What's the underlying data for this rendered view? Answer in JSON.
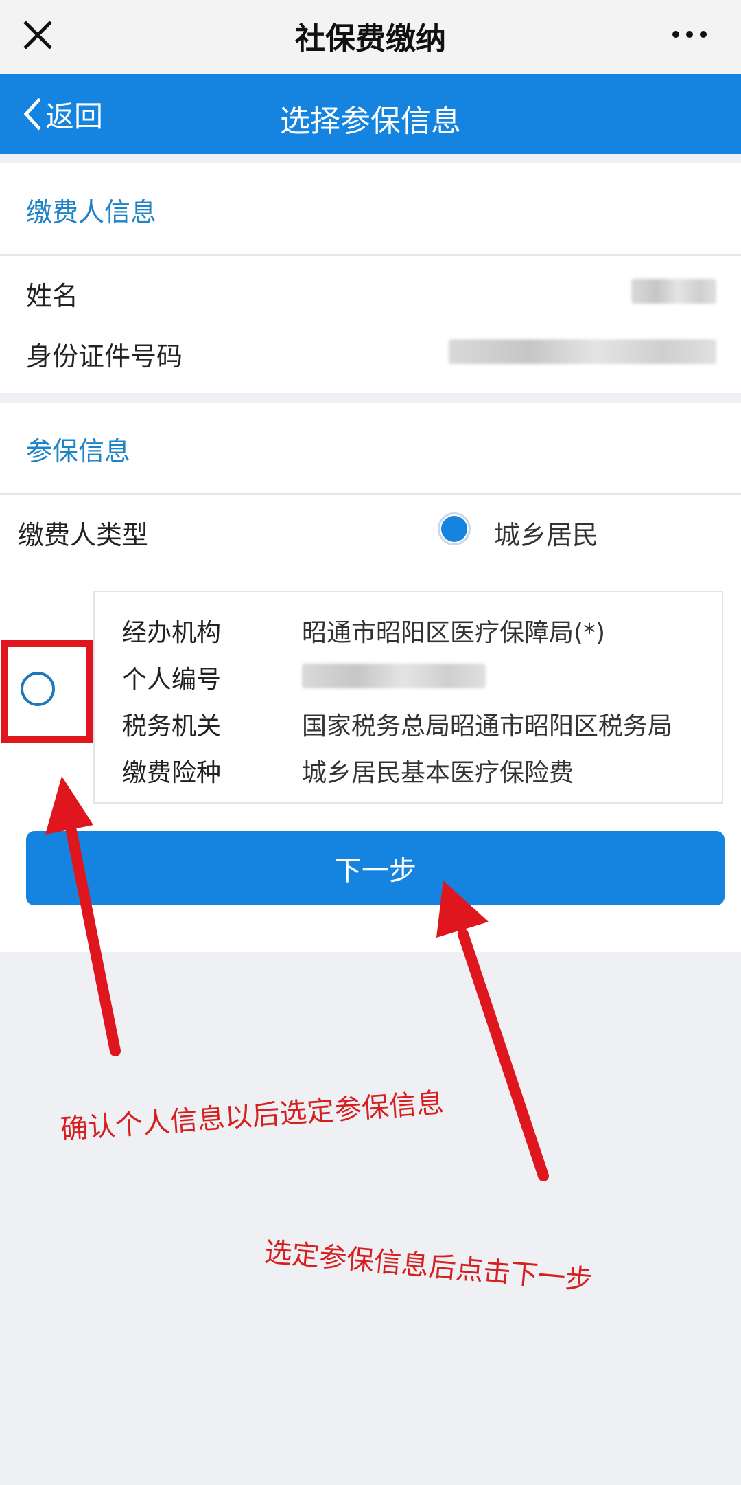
{
  "topbar": {
    "title": "社保费缴纳"
  },
  "navbar": {
    "back_label": "返回",
    "title": "选择参保信息"
  },
  "payer_section": {
    "header": "缴费人信息",
    "fields": [
      {
        "label": "姓名"
      },
      {
        "label": "身份证件号码"
      }
    ]
  },
  "insured_section": {
    "header": "参保信息",
    "payer_type_label": "缴费人类型",
    "payer_type_option": "城乡居民"
  },
  "record": {
    "rows": [
      {
        "k": "经办机构",
        "v": "昭通市昭阳区医疗保障局(*)"
      },
      {
        "k": "个人编号",
        "v": ""
      },
      {
        "k": "税务机关",
        "v": "国家税务总局昭通市昭阳区税务局"
      },
      {
        "k": "缴费险种",
        "v": "城乡居民基本医疗保险费"
      }
    ]
  },
  "next_button": {
    "label": "下一步"
  },
  "annotations": {
    "select_info": "确认个人信息以后选定参保信息",
    "click_next": "选定参保信息后点击下一步"
  },
  "colors": {
    "primary": "#1584e0",
    "annotation_red": "#e0161f",
    "section_blue": "#1f83c7"
  }
}
